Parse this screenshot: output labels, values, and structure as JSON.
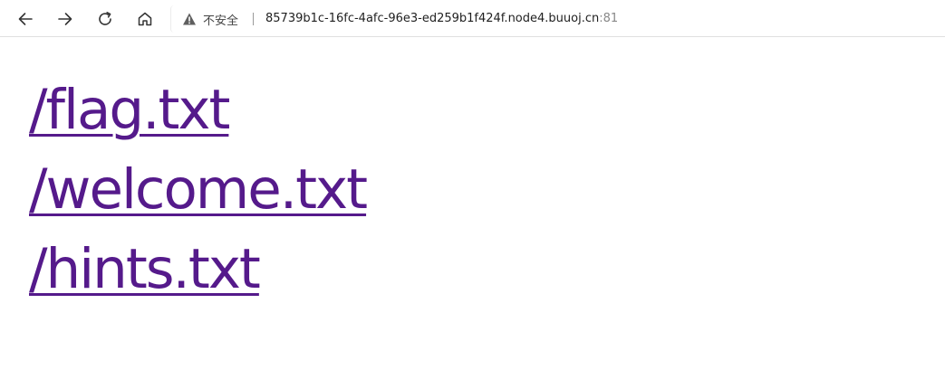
{
  "browser": {
    "security_label": "不安全",
    "url_host": "85739b1c-16fc-4afc-96e3-ed259b1f424f.node4.buuoj.cn",
    "url_port": ":81",
    "icons": {
      "back": "arrow-left-icon",
      "forward": "arrow-right-icon",
      "reload": "reload-icon",
      "home": "home-icon",
      "security": "warning-triangle-icon"
    }
  },
  "page": {
    "links": [
      {
        "text": "/flag.txt",
        "href": "/flag.txt"
      },
      {
        "text": "/welcome.txt",
        "href": "/welcome.txt"
      },
      {
        "text": "/hints.txt",
        "href": "/hints.txt"
      }
    ],
    "link_color": "#551a8b"
  }
}
